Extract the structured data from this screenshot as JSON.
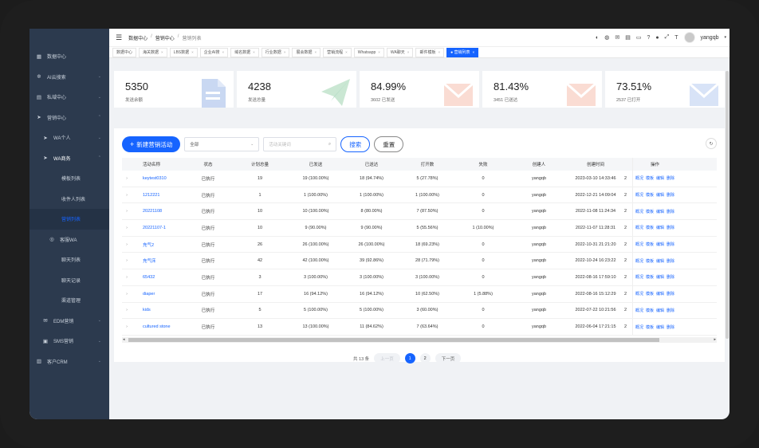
{
  "sidebar": {
    "items": [
      {
        "icon": "dashboard-icon",
        "glyph": "▦",
        "label": "数据中心",
        "chev": "",
        "level": "top"
      },
      {
        "icon": "search-icon",
        "glyph": "✲",
        "label": "AI云搜索",
        "chev": "⌄",
        "level": "top"
      },
      {
        "icon": "folder-icon",
        "glyph": "▤",
        "label": "私域中心",
        "chev": "⌄",
        "level": "top"
      },
      {
        "icon": "send-icon",
        "glyph": "➤",
        "label": "营销中心",
        "chev": "⌃",
        "level": "top"
      },
      {
        "icon": "send-icon",
        "glyph": "➤",
        "label": "WA个人",
        "chev": "⌄",
        "level": "sub"
      },
      {
        "icon": "send-icon",
        "glyph": "➤",
        "label": "WA商务",
        "chev": "⌃",
        "level": "sub-bright"
      },
      {
        "icon": "",
        "glyph": "",
        "label": "模板列表",
        "chev": "",
        "level": "sub2"
      },
      {
        "icon": "",
        "glyph": "",
        "label": "收件人列表",
        "chev": "",
        "level": "sub2"
      },
      {
        "icon": "",
        "glyph": "",
        "label": "营销列表",
        "chev": "",
        "level": "sub2-active"
      },
      {
        "icon": "chat-icon",
        "glyph": "◎",
        "label": "客服WA",
        "chev": "",
        "level": "sub3"
      },
      {
        "icon": "",
        "glyph": "",
        "label": "聊天列表",
        "chev": "",
        "level": "sub2"
      },
      {
        "icon": "",
        "glyph": "",
        "label": "聊天记录",
        "chev": "",
        "level": "sub2"
      },
      {
        "icon": "",
        "glyph": "",
        "label": "渠道管理",
        "chev": "",
        "level": "sub2"
      },
      {
        "icon": "mail-icon",
        "glyph": "✉",
        "label": "EDM营销",
        "chev": "⌄",
        "level": "sub"
      },
      {
        "icon": "sms-icon",
        "glyph": "▣",
        "label": "SMS营销",
        "chev": "⌄",
        "level": "sub"
      },
      {
        "icon": "crm-icon",
        "glyph": "▥",
        "label": "客户CRM",
        "chev": "⌄",
        "level": "top"
      }
    ]
  },
  "header": {
    "breadcrumb": [
      "数据中心",
      "营销中心",
      "营销列表"
    ],
    "separator": "/",
    "username": "yangqb",
    "icons": [
      {
        "name": "globe-icon",
        "glyph": "◐"
      },
      {
        "name": "whatsapp-icon",
        "glyph": "◍"
      },
      {
        "name": "mail-icon",
        "glyph": "✉"
      },
      {
        "name": "inbox-icon",
        "glyph": "▤"
      },
      {
        "name": "monitor-icon",
        "glyph": "▭"
      },
      {
        "name": "help-icon",
        "glyph": "?"
      },
      {
        "name": "github-icon",
        "glyph": "●"
      },
      {
        "name": "fullscreen-icon",
        "glyph": "⤢"
      },
      {
        "name": "font-size-icon",
        "glyph": "T"
      }
    ]
  },
  "tabs": [
    {
      "label": "数据中心",
      "closable": false,
      "active": false
    },
    {
      "label": "海关数据",
      "closable": true,
      "active": false
    },
    {
      "label": "LBS数据",
      "closable": true,
      "active": false
    },
    {
      "label": "企业AI搜",
      "closable": true,
      "active": false
    },
    {
      "label": "域名数据",
      "closable": true,
      "active": false
    },
    {
      "label": "行业数据",
      "closable": true,
      "active": false
    },
    {
      "label": "展会数据",
      "closable": true,
      "active": false
    },
    {
      "label": "营销流程",
      "closable": true,
      "active": false
    },
    {
      "label": "Whatsapp",
      "closable": true,
      "active": false
    },
    {
      "label": "WA聊天",
      "closable": true,
      "active": false
    },
    {
      "label": "邮件模板",
      "closable": true,
      "active": false
    },
    {
      "label": "● 营销列表",
      "closable": true,
      "active": true
    }
  ],
  "stats": [
    {
      "value": "5350",
      "label": "发送余额",
      "art": "doc"
    },
    {
      "value": "4238",
      "label": "发送总量",
      "art": "plane"
    },
    {
      "value": "84.99%",
      "label": "3602 已发送",
      "art": "mail-red"
    },
    {
      "value": "81.43%",
      "label": "3451 已送达",
      "art": "mail-red"
    },
    {
      "value": "73.51%",
      "label": "2537 已打开",
      "art": "mail-blue"
    }
  ],
  "toolbar": {
    "new_label": "新建营销活动",
    "select_value": "全部",
    "search_placeholder": "活动关键词",
    "search_label": "搜索",
    "reset_label": "重置"
  },
  "table": {
    "headers": [
      "活动名称",
      "状态",
      "计划总量",
      "已发送",
      "已送达",
      "打开数",
      "失败",
      "创建人",
      "创建时间",
      "操作"
    ],
    "ops": [
      "概况",
      "模板",
      "编辑",
      "删除"
    ],
    "rows": [
      [
        "keytest0310",
        "已执行",
        "19",
        "19 (100.00%)",
        "18 (94.74%)",
        "5 (27.78%)",
        "0",
        "yangqb",
        "2023-03-10 14:33:46"
      ],
      [
        "1212221",
        "已执行",
        "1",
        "1 (100.00%)",
        "1 (100.00%)",
        "1 (100.00%)",
        "0",
        "yangqb",
        "2022-12-21 14:09:04"
      ],
      [
        "20221108",
        "已执行",
        "10",
        "10 (100.00%)",
        "8 (80.00%)",
        "7 (87.50%)",
        "0",
        "yangqb",
        "2022-11-08 11:24:34"
      ],
      [
        "20221107-1",
        "已执行",
        "10",
        "9 (90.00%)",
        "9 (90.00%)",
        "5 (55.56%)",
        "1 (10.00%)",
        "yangqb",
        "2022-11-07 11:28:31"
      ],
      [
        "充气2",
        "已执行",
        "26",
        "26 (100.00%)",
        "26 (100.00%)",
        "18 (69.23%)",
        "0",
        "yangqb",
        "2022-10-31 21:21:20"
      ],
      [
        "充气床",
        "已执行",
        "42",
        "42 (100.00%)",
        "39 (92.86%)",
        "28 (71.79%)",
        "0",
        "yangqb",
        "2022-10-24 16:23:22"
      ],
      [
        "65432",
        "已执行",
        "3",
        "3 (100.00%)",
        "3 (100.00%)",
        "3 (100.00%)",
        "0",
        "yangqb",
        "2022-08-16 17:59:10"
      ],
      [
        "diaper",
        "已执行",
        "17",
        "16 (94.12%)",
        "16 (94.12%)",
        "10 (62.50%)",
        "1 (5.88%)",
        "yangqb",
        "2022-08-16 15:12:29"
      ],
      [
        "kids",
        "已执行",
        "5",
        "5 (100.00%)",
        "5 (100.00%)",
        "3 (60.00%)",
        "0",
        "yangqb",
        "2022-07-22 10:21:56"
      ],
      [
        "cultured stone",
        "已执行",
        "13",
        "13 (100.00%)",
        "11 (84.62%)",
        "7 (63.64%)",
        "0",
        "yangqb",
        "2022-06-04 17:21:15"
      ]
    ],
    "cut_col": "2"
  },
  "pager": {
    "total": "共 13 条",
    "prev": "上一页",
    "pages": [
      "1",
      "2"
    ],
    "current": "1",
    "next": "下一页"
  },
  "colors": {
    "accent": "#1664ff",
    "sidebar": "#2c3a4e"
  }
}
